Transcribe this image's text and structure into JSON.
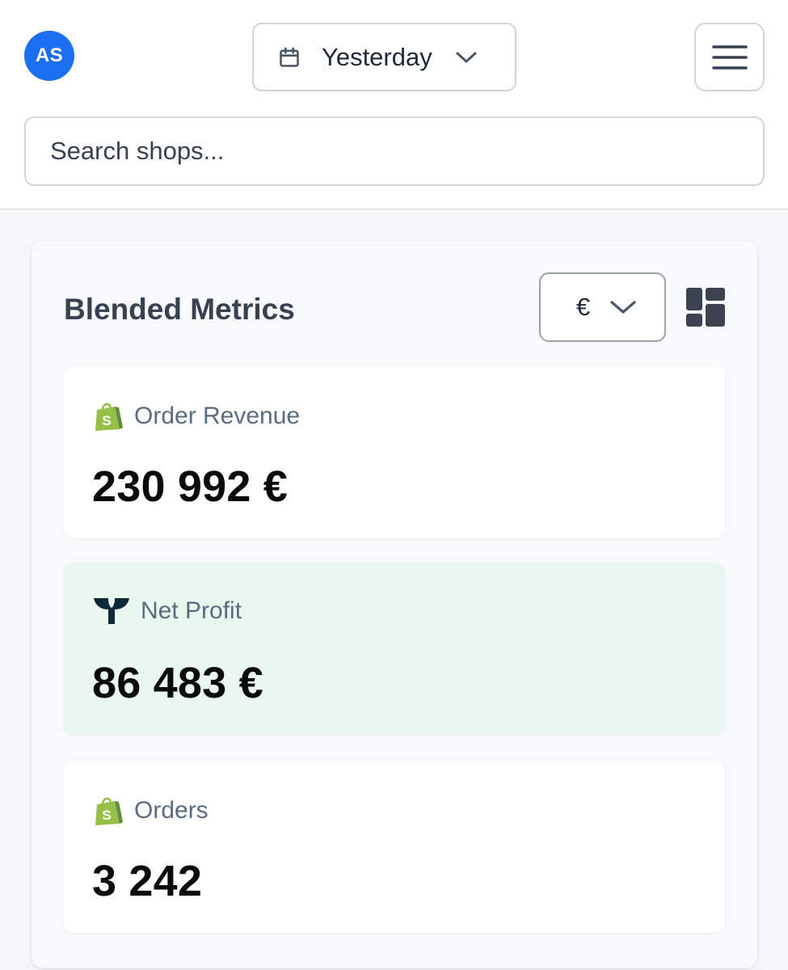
{
  "header": {
    "avatar_initials": "AS",
    "date_range": {
      "label": "Yesterday",
      "icon": "calendar-icon"
    },
    "menu_icon": "hamburger-menu-icon",
    "search": {
      "value": "",
      "placeholder": "Search shops..."
    }
  },
  "panel": {
    "title": "Blended Metrics",
    "currency": {
      "symbol": "€",
      "icon": "chevron-down-icon"
    },
    "layout_icon": "dashboard-layout-icon",
    "cards": [
      {
        "label": "Order Revenue",
        "value": "230 992 €",
        "icon": "shopify-bag-icon"
      },
      {
        "label": "Net Profit",
        "value": "86 483 €",
        "icon": "brand-logo-icon"
      },
      {
        "label": "Orders",
        "value": "3 242",
        "icon": "shopify-bag-icon"
      }
    ]
  },
  "colors": {
    "avatar_bg": "#1d6ff2",
    "net_profit_card_bg": "#e9f7ef",
    "shopify_green": "#95bf47",
    "brand_dark": "#0e2a3a"
  }
}
